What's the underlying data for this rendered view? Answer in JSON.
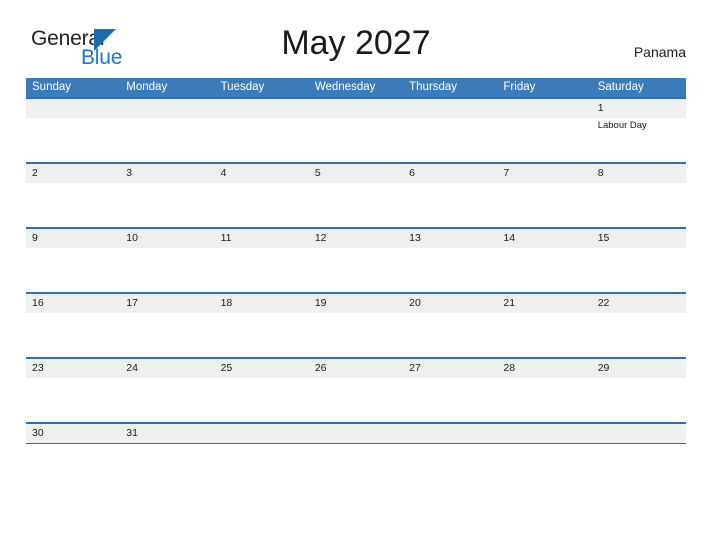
{
  "brand": {
    "name_part1": "General",
    "name_part2": "Blue",
    "triangle_color": "#1b6cb3",
    "blue_color": "#1b77c9"
  },
  "header": {
    "title": "May 2027",
    "country": "Panama"
  },
  "theme": {
    "header_blue": "#3a7cba",
    "row_border_blue": "#2f6fb0",
    "daynum_band_gray": "#efefef",
    "text_color": "#1a1a1a",
    "page_background": "#ffffff"
  },
  "calendar": {
    "month": "May",
    "year": "2027",
    "weekdays": [
      "Sunday",
      "Monday",
      "Tuesday",
      "Wednesday",
      "Thursday",
      "Friday",
      "Saturday"
    ],
    "weeks": [
      {
        "days": [
          {
            "number": "",
            "events": []
          },
          {
            "number": "",
            "events": []
          },
          {
            "number": "",
            "events": []
          },
          {
            "number": "",
            "events": []
          },
          {
            "number": "",
            "events": []
          },
          {
            "number": "",
            "events": []
          },
          {
            "number": "1",
            "events": [
              "Labour Day"
            ]
          }
        ]
      },
      {
        "days": [
          {
            "number": "2",
            "events": []
          },
          {
            "number": "3",
            "events": []
          },
          {
            "number": "4",
            "events": []
          },
          {
            "number": "5",
            "events": []
          },
          {
            "number": "6",
            "events": []
          },
          {
            "number": "7",
            "events": []
          },
          {
            "number": "8",
            "events": []
          }
        ]
      },
      {
        "days": [
          {
            "number": "9",
            "events": []
          },
          {
            "number": "10",
            "events": []
          },
          {
            "number": "11",
            "events": []
          },
          {
            "number": "12",
            "events": []
          },
          {
            "number": "13",
            "events": []
          },
          {
            "number": "14",
            "events": []
          },
          {
            "number": "15",
            "events": []
          }
        ]
      },
      {
        "days": [
          {
            "number": "16",
            "events": []
          },
          {
            "number": "17",
            "events": []
          },
          {
            "number": "18",
            "events": []
          },
          {
            "number": "19",
            "events": []
          },
          {
            "number": "20",
            "events": []
          },
          {
            "number": "21",
            "events": []
          },
          {
            "number": "22",
            "events": []
          }
        ]
      },
      {
        "days": [
          {
            "number": "23",
            "events": []
          },
          {
            "number": "24",
            "events": []
          },
          {
            "number": "25",
            "events": []
          },
          {
            "number": "26",
            "events": []
          },
          {
            "number": "27",
            "events": []
          },
          {
            "number": "28",
            "events": []
          },
          {
            "number": "29",
            "events": []
          }
        ]
      },
      {
        "days": [
          {
            "number": "30",
            "events": []
          },
          {
            "number": "31",
            "events": []
          },
          {
            "number": "",
            "events": []
          },
          {
            "number": "",
            "events": []
          },
          {
            "number": "",
            "events": []
          },
          {
            "number": "",
            "events": []
          },
          {
            "number": "",
            "events": []
          }
        ]
      }
    ]
  }
}
